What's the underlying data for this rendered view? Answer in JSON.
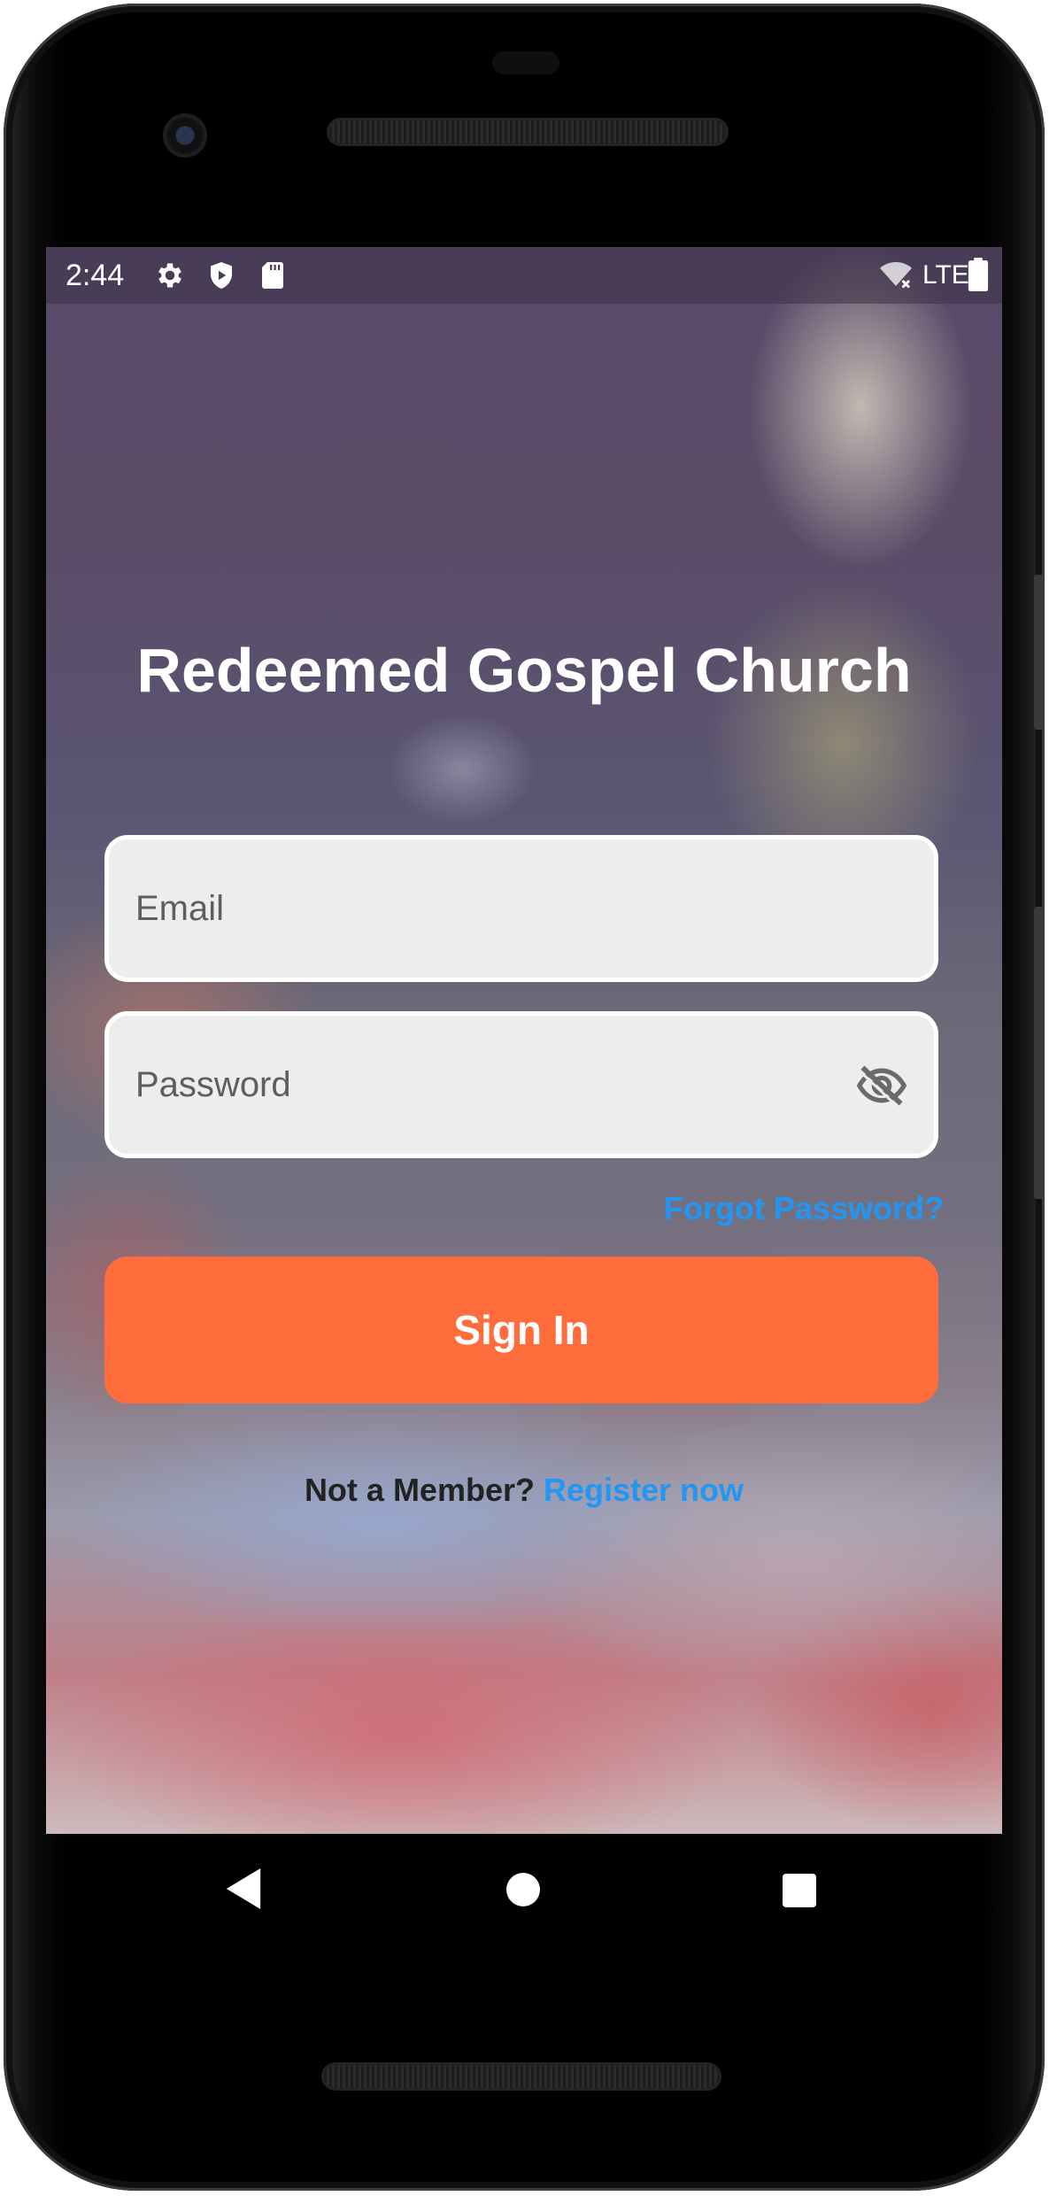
{
  "status_bar": {
    "time": "2:44",
    "network": "LTE",
    "icons": [
      "settings-icon",
      "shield-play-icon",
      "sd-card-icon",
      "wifi-off-icon",
      "battery-icon"
    ]
  },
  "app": {
    "title": "Redeemed Gospel Church"
  },
  "login_form": {
    "email_placeholder": "Email",
    "password_placeholder": "Password",
    "password_toggle_icon": "eye-off-icon",
    "forgot_password": "Forgot Password?",
    "sign_in_label": "Sign In",
    "register_prompt": "Not a Member?",
    "register_link": "Register now"
  },
  "navigation_bar": {
    "buttons": [
      "back",
      "home",
      "recents"
    ]
  },
  "colors": {
    "accent": "#ff6d3d",
    "link": "#2196f3",
    "field_background": "#ededed",
    "title_text": "#ffffff"
  }
}
